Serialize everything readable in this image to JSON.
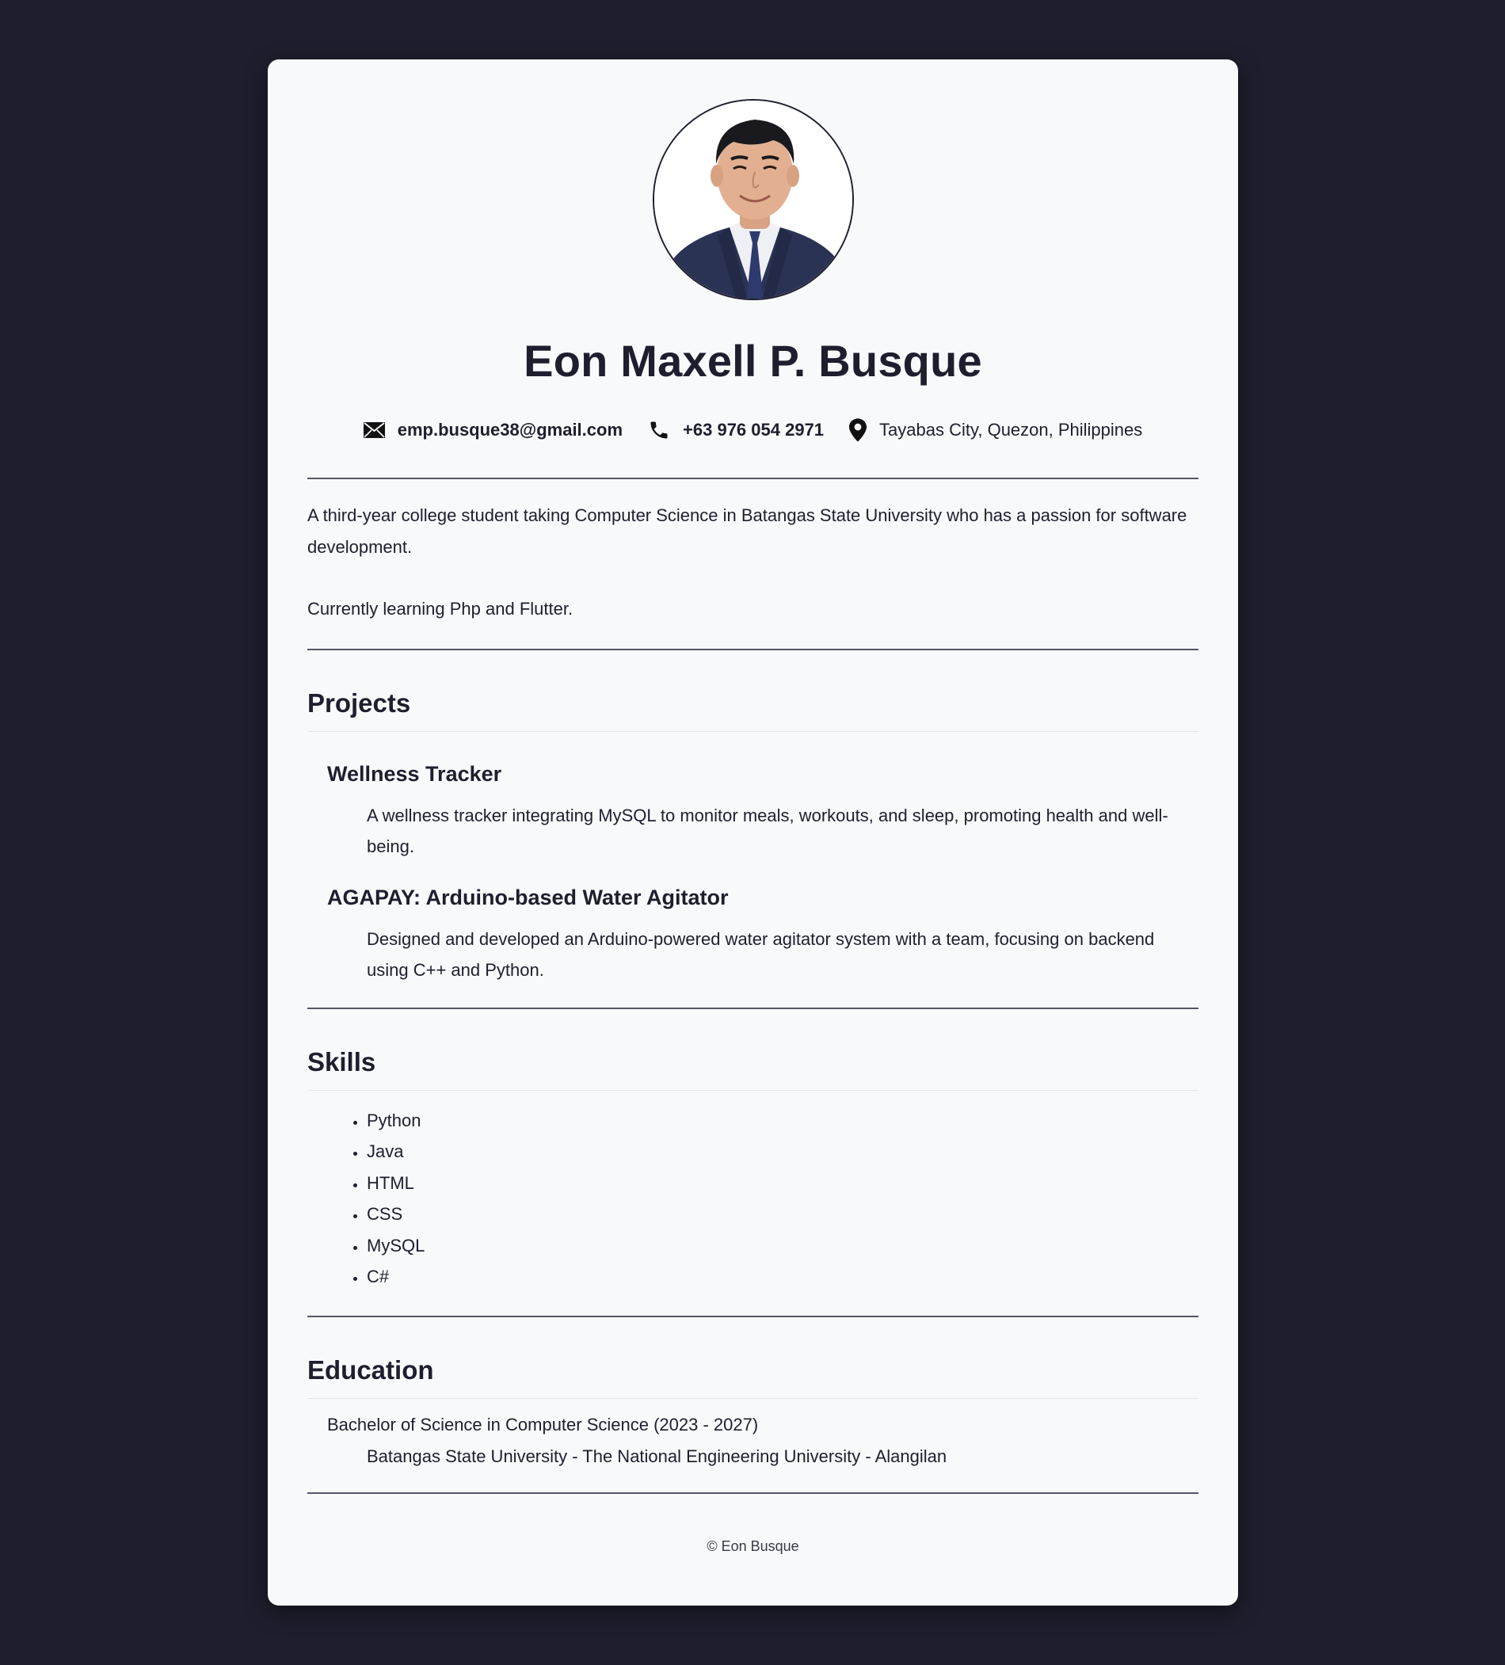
{
  "profile": {
    "name": "Eon Maxell P. Busque",
    "photo_alt": "Profile photo"
  },
  "contacts": {
    "email": "emp.busque38@gmail.com",
    "phone": "+63 976 054 2971",
    "location": "Tayabas City, Quezon, Philippines"
  },
  "about": {
    "paragraph1": "A third-year college student taking Computer Science in Batangas State University who has a passion for software development.",
    "paragraph2": "Currently learning Php and Flutter."
  },
  "projects": {
    "title": "Projects",
    "items": [
      {
        "name": "Wellness Tracker",
        "description": "A wellness tracker integrating MySQL to monitor meals, workouts, and sleep, promoting health and well-being."
      },
      {
        "name": "AGAPAY: Arduino-based Water Agitator",
        "description": "Designed and developed an Arduino-powered water agitator system with a team, focusing on backend using C++ and Python."
      }
    ]
  },
  "skills": {
    "title": "Skills",
    "items": [
      "Python",
      "Java",
      "HTML",
      "CSS",
      "MySQL",
      "C#"
    ]
  },
  "education": {
    "title": "Education",
    "degree": "Bachelor of Science in Computer Science (2023 - 2027)",
    "school": "Batangas State University - The National Engineering University - Alangilan"
  },
  "footer": {
    "copyright": "© Eon Busque"
  },
  "icons": {
    "email": "envelope-icon",
    "phone": "phone-icon",
    "location": "map-pin-icon"
  },
  "colors": {
    "page_background": "#1e1e2e",
    "card_background": "#f8f9fb",
    "text": "#1e1e2e"
  }
}
